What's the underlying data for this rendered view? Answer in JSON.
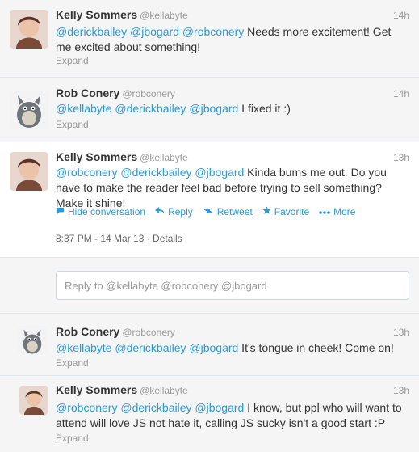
{
  "tweets": [
    {
      "name": "Kelly Sommers",
      "handle": "@kellabyte",
      "time": "14h",
      "mentions": "@derickbailey @jbogard @robconery",
      "text": " Needs more excitement! Get me excited about something!",
      "expand": "Expand"
    },
    {
      "name": "Rob Conery",
      "handle": "@robconery",
      "time": "14h",
      "mentions": "@kellabyte @derickbailey @jbogard",
      "text": " I fixed it :)",
      "expand": "Expand"
    },
    {
      "name": "Kelly Sommers",
      "handle": "@kellabyte",
      "time": "13h",
      "mentions": "@robconery @derickbailey @jbogard",
      "text": " Kinda bums me out. Do you have to make the reader feel bad before trying to sell something? Make it shine!",
      "actions": {
        "hide_conversation": "Hide conversation",
        "reply": "Reply",
        "retweet": "Retweet",
        "favorite": "Favorite",
        "more": "More"
      },
      "meta": "8:37 PM - 14 Mar 13 · Details"
    },
    {
      "name": "Rob Conery",
      "handle": "@robconery",
      "time": "13h",
      "mentions": "@kellabyte @derickbailey @jbogard",
      "text": " It's tongue in cheek! Come on!",
      "expand": "Expand"
    },
    {
      "name": "Kelly Sommers",
      "handle": "@kellabyte",
      "time": "13h",
      "mentions": "@robconery @derickbailey @jbogard",
      "text": " I know, but ppl who will want to attend will love JS not hate it, calling JS sucky isn't a good start :P",
      "expand": "Expand"
    }
  ],
  "reply_box": {
    "placeholder": "Reply to @kellabyte @robconery @jbogard"
  },
  "colors": {
    "link": "#2b9ad6",
    "muted": "#999999"
  }
}
